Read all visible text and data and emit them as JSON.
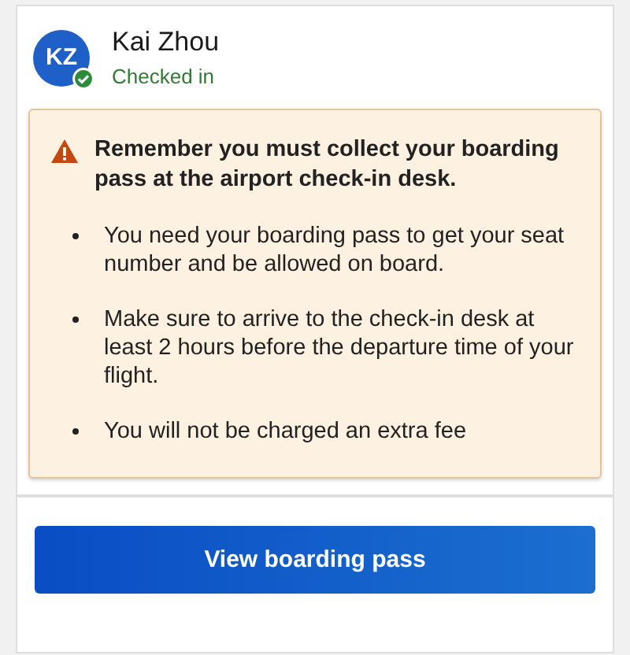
{
  "passenger": {
    "initials": "KZ",
    "name": "Kai Zhou",
    "status": "Checked in",
    "checked_in": true
  },
  "notice": {
    "title": "Remember you must collect your boarding pass at the airport check-in desk.",
    "items": [
      "You need your boarding pass to get your seat number and be allowed on board.",
      "Make sure to arrive to the check-in desk at least 2 hours before the departure time of your flight.",
      "You will not be charged an extra fee"
    ]
  },
  "button": {
    "label": "View boarding pass"
  }
}
